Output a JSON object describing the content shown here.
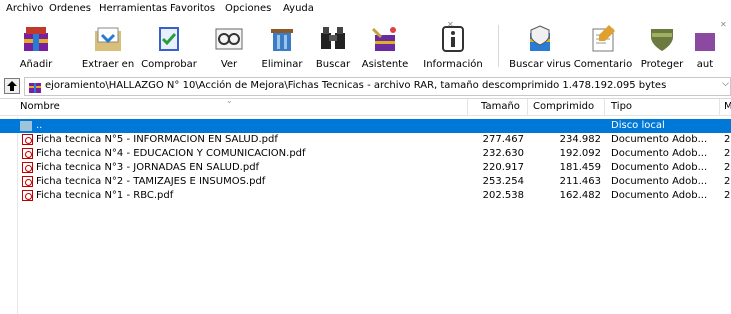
{
  "menu": [
    "Archivo",
    "Ordenes",
    "Herramientas",
    "Favoritos",
    "Opciones",
    "Ayuda"
  ],
  "toolbar": [
    {
      "label": "Añadir",
      "icon": "add-archive-icon"
    },
    {
      "label": "Extraer en",
      "icon": "extract-to-icon"
    },
    {
      "label": "Comprobar",
      "icon": "test-icon"
    },
    {
      "label": "Ver",
      "icon": "view-icon"
    },
    {
      "label": "Eliminar",
      "icon": "delete-icon"
    },
    {
      "label": "Buscar",
      "icon": "find-icon"
    },
    {
      "label": "Asistente",
      "icon": "wizard-icon"
    },
    {
      "label": "Información",
      "icon": "info-icon"
    },
    {
      "label": "Buscar virus",
      "icon": "virus-scan-icon"
    },
    {
      "label": "Comentario",
      "icon": "comment-icon"
    },
    {
      "label": "Proteger",
      "icon": "protect-icon"
    },
    {
      "label": "aut",
      "icon": "sfx-icon"
    }
  ],
  "address": "ejoramiento\\HALLAZGO N° 10\\Acción de Mejora\\Fichas Tecnicas - archivo RAR, tamaño descomprimido 1.478.192.095 bytes",
  "columns": {
    "name": "Nombre",
    "size": "Tamaño",
    "packed": "Comprimido",
    "type": "Tipo",
    "modified": "M"
  },
  "parent_row": {
    "name": "..",
    "type": "Disco local"
  },
  "files": [
    {
      "name": "Ficha tecnica N°5 - INFORMACION EN SALUD.pdf",
      "size": "277.467",
      "packed": "234.982",
      "type": "Documento Adob...",
      "modified": "2"
    },
    {
      "name": "Ficha tecnica N°4 - EDUCACION Y COMUNICACION.pdf",
      "size": "232.630",
      "packed": "192.092",
      "type": "Documento Adob...",
      "modified": "2"
    },
    {
      "name": "Ficha tecnica N°3 - JORNADAS EN SALUD.pdf",
      "size": "220.917",
      "packed": "181.459",
      "type": "Documento Adob...",
      "modified": "2"
    },
    {
      "name": "Ficha tecnica N°2 - TAMIZAJES E INSUMOS.pdf",
      "size": "253.254",
      "packed": "211.463",
      "type": "Documento Adob...",
      "modified": "2"
    },
    {
      "name": "Ficha tecnica N°1 - RBC.pdf",
      "size": "202.538",
      "packed": "162.482",
      "type": "Documento Adob...",
      "modified": "2"
    }
  ]
}
